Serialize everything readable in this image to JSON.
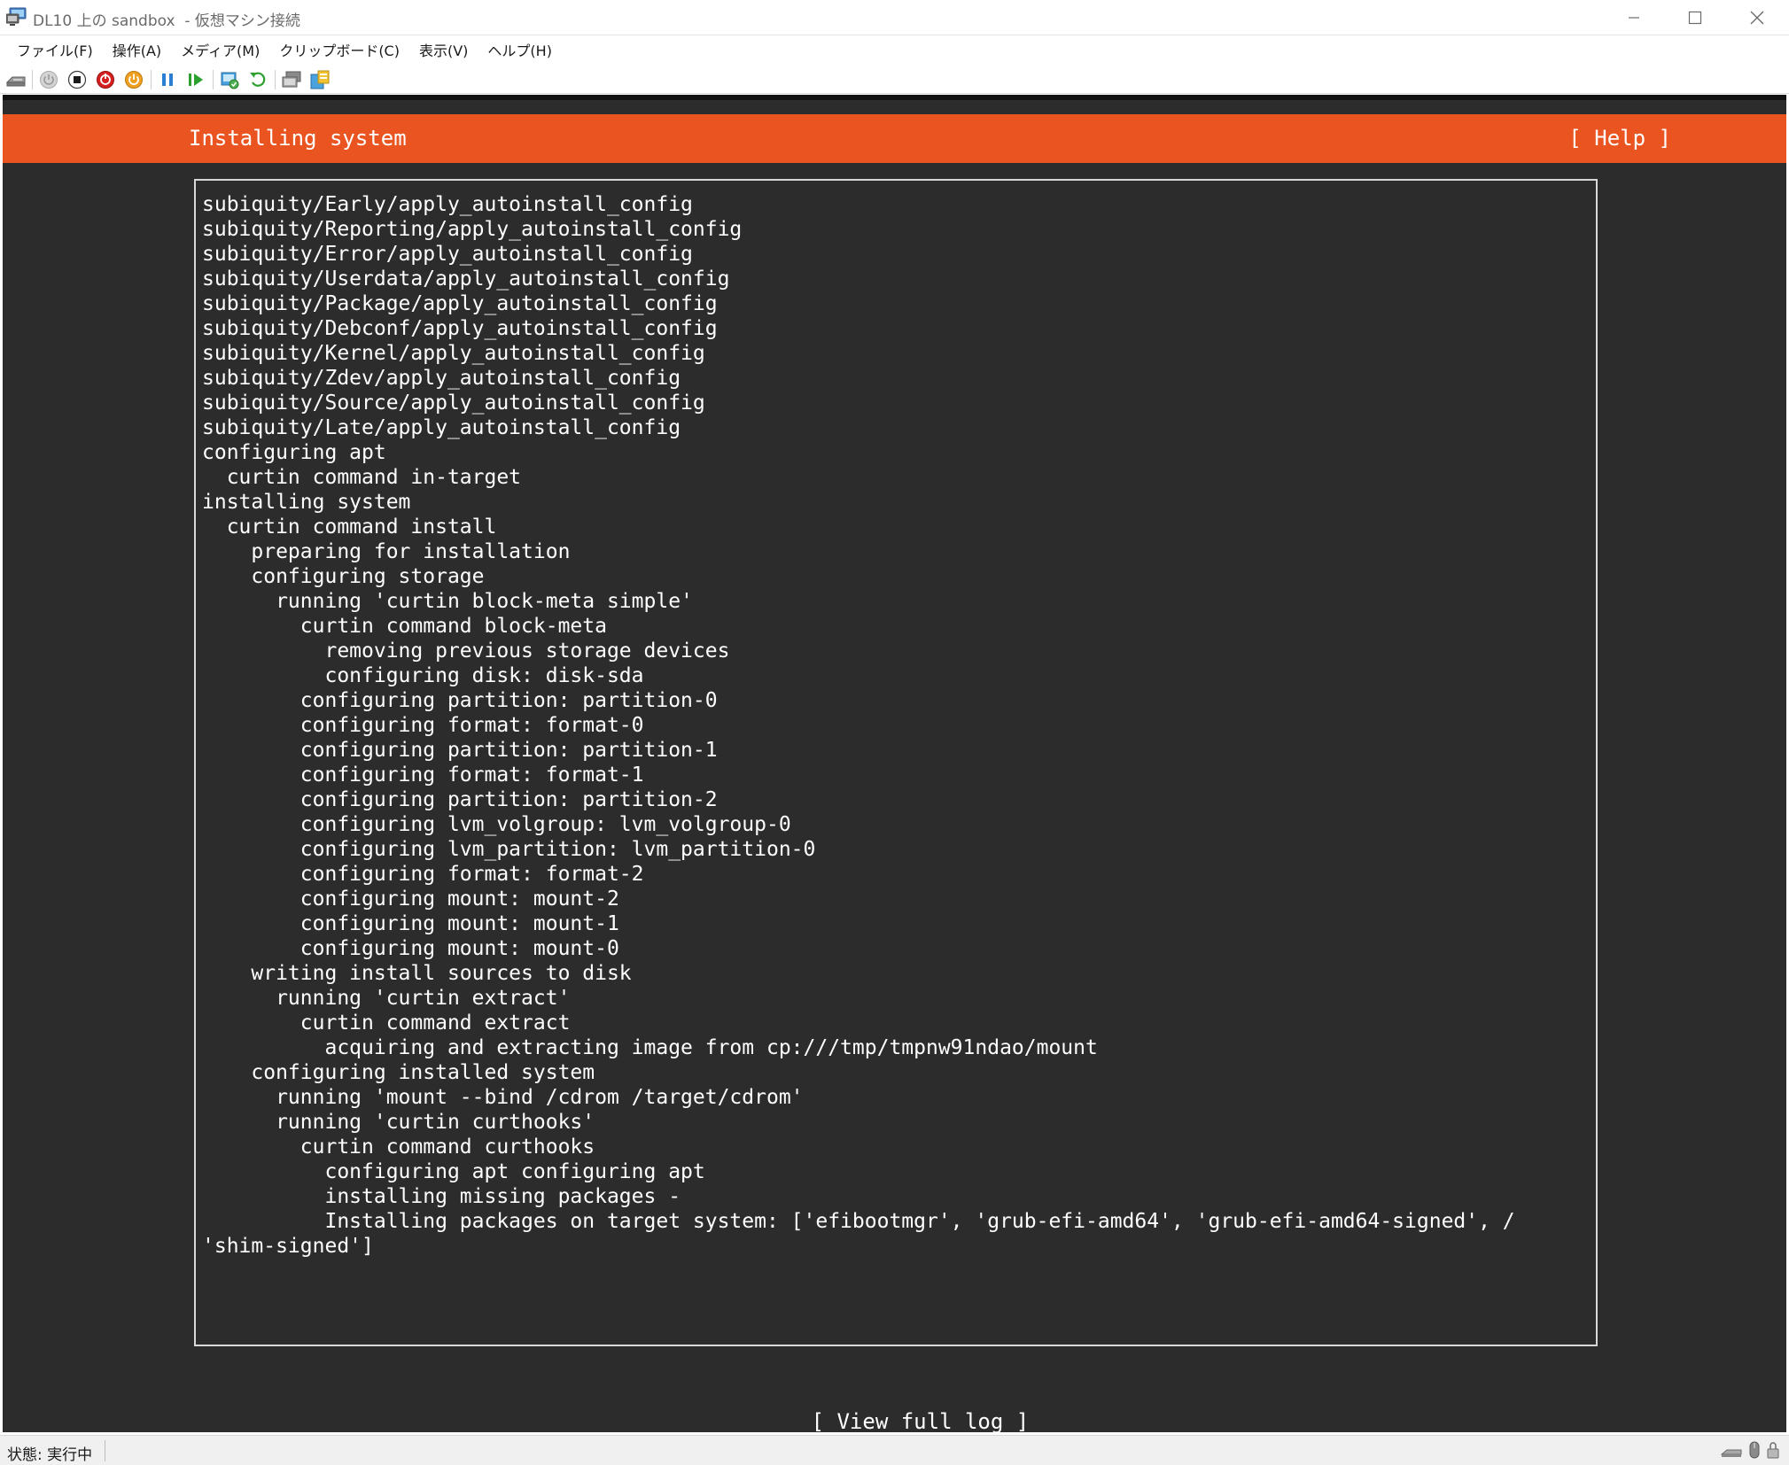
{
  "window": {
    "title": "DL10 上の sandbox  - 仮想マシン接続"
  },
  "menu": [
    "ファイル(F)",
    "操作(A)",
    "メディア(M)",
    "クリップボード(C)",
    "表示(V)",
    "ヘルプ(H)"
  ],
  "toolbar": {
    "icons": [
      "ctrl-alt-del-icon",
      "start-icon",
      "turn-off-icon",
      "shut-down-icon",
      "save-icon",
      "pause-icon",
      "resume-icon",
      "checkpoint-icon",
      "revert-icon",
      "enhanced-session-icon",
      "share-icon"
    ]
  },
  "installer": {
    "header_title": "Installing system",
    "help_label": "[ Help ]",
    "view_log_label": "[ View full log ]",
    "accent_color": "#e95420",
    "log_lines": [
      "subiquity/Early/apply_autoinstall_config",
      "subiquity/Reporting/apply_autoinstall_config",
      "subiquity/Error/apply_autoinstall_config",
      "subiquity/Userdata/apply_autoinstall_config",
      "subiquity/Package/apply_autoinstall_config",
      "subiquity/Debconf/apply_autoinstall_config",
      "subiquity/Kernel/apply_autoinstall_config",
      "subiquity/Zdev/apply_autoinstall_config",
      "subiquity/Source/apply_autoinstall_config",
      "subiquity/Late/apply_autoinstall_config",
      "configuring apt",
      "  curtin command in-target",
      "installing system",
      "  curtin command install",
      "    preparing for installation",
      "    configuring storage",
      "      running 'curtin block-meta simple'",
      "        curtin command block-meta",
      "          removing previous storage devices",
      "          configuring disk: disk-sda",
      "        configuring partition: partition-0",
      "        configuring format: format-0",
      "        configuring partition: partition-1",
      "        configuring format: format-1",
      "        configuring partition: partition-2",
      "        configuring lvm_volgroup: lvm_volgroup-0",
      "        configuring lvm_partition: lvm_partition-0",
      "        configuring format: format-2",
      "        configuring mount: mount-2",
      "        configuring mount: mount-1",
      "        configuring mount: mount-0",
      "    writing install sources to disk",
      "      running 'curtin extract'",
      "        curtin command extract",
      "          acquiring and extracting image from cp:///tmp/tmpnw91ndao/mount",
      "    configuring installed system",
      "      running 'mount --bind /cdrom /target/cdrom'",
      "      running 'curtin curthooks'",
      "        curtin command curthooks",
      "          configuring apt configuring apt",
      "          installing missing packages -",
      "          Installing packages on target system: ['efibootmgr', 'grub-efi-amd64', 'grub-efi-amd64-signed', /",
      "'shim-signed']"
    ]
  },
  "status": {
    "text": "状態: 実行中"
  }
}
